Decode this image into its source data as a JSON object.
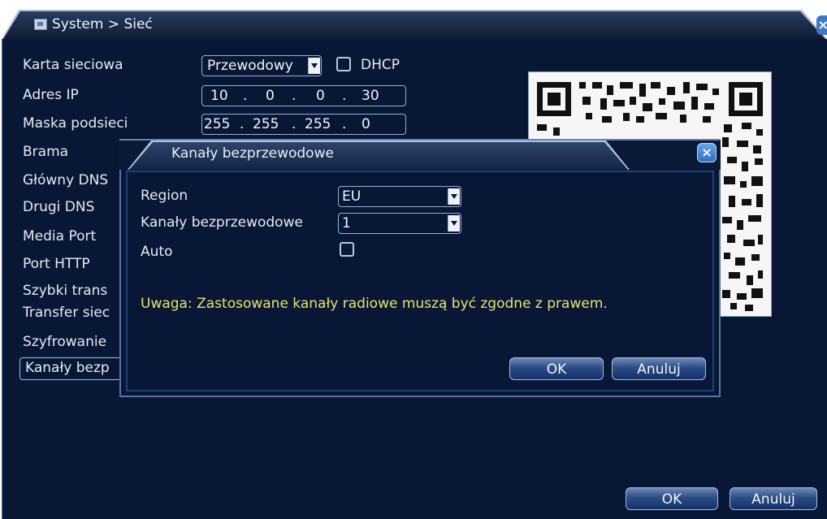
{
  "window": {
    "title": "System > Sieć",
    "close_glyph": "×"
  },
  "settings": {
    "network_card_label": "Karta sieciowa",
    "network_card_value": "Przewodowy",
    "dhcp_label": "DHCP",
    "ip_label": "Adres IP",
    "ip_octets": [
      "10",
      "0",
      "0",
      "30"
    ],
    "mask_label": "Maska podsieci",
    "mask_octets": [
      "255",
      "255",
      "255",
      "0"
    ],
    "gateway_label": "Brama",
    "primary_dns_label": "Główny DNS",
    "secondary_dns_label": "Drugi DNS",
    "media_port_label": "Media Port",
    "http_port_label": "Port HTTP",
    "fast_transfer_label": "Szybki trans",
    "net_transfer_label": "Transfer siec",
    "encryption_label": "Szyfrowanie",
    "wireless_channels_item": "Kanały bezp"
  },
  "footer": {
    "ok_label": "OK",
    "cancel_label": "Anuluj"
  },
  "dialog": {
    "title": "Kanały bezprzewodowe",
    "close_glyph": "×",
    "region_label": "Region",
    "region_value": "EU",
    "channel_label": "Kanały bezprzewodowe",
    "channel_value": "1",
    "auto_label": "Auto",
    "warning": "Uwaga: Zastosowane kanały radiowe muszą być zgodne z prawem.",
    "ok_label": "OK",
    "cancel_label": "Anuluj"
  },
  "icons": {
    "window_icon": "network-window-icon",
    "dropdown_icon": "chevron-down-icon",
    "close_icon": "close-icon",
    "qr_code": "qr-code-image"
  },
  "colors": {
    "background": "#071735",
    "warning_text": "#e8e46a",
    "border": "#9ab0d6"
  }
}
